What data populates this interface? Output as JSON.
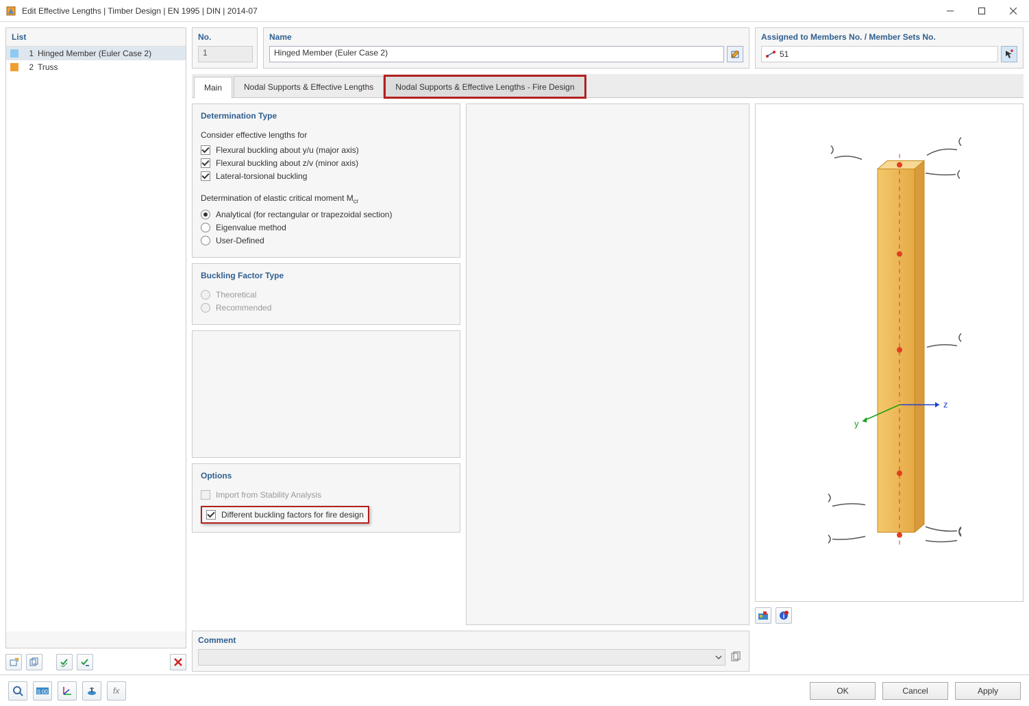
{
  "window": {
    "title": "Edit Effective Lengths | Timber Design | EN 1995 | DIN | 2014-07"
  },
  "list": {
    "header": "List",
    "items": [
      {
        "idx": "1",
        "name": "Hinged Member (Euler Case 2)",
        "color": "#8fcaf0",
        "selected": true
      },
      {
        "idx": "2",
        "name": "Truss",
        "color": "#f0a030",
        "selected": false
      }
    ]
  },
  "no_group": {
    "header": "No.",
    "value": "1"
  },
  "name_group": {
    "header": "Name",
    "value": "Hinged Member (Euler Case 2)"
  },
  "assigned_group": {
    "header": "Assigned to Members No. / Member Sets No.",
    "value": "51"
  },
  "tabs": {
    "main": "Main",
    "nodal": "Nodal Supports & Effective Lengths",
    "nodal_fire": "Nodal Supports & Effective Lengths - Fire Design"
  },
  "determination": {
    "header": "Determination Type",
    "sub1": "Consider effective lengths for",
    "c1": "Flexural buckling about y/u (major axis)",
    "c2": "Flexural buckling about z/v (minor axis)",
    "c3": "Lateral-torsional buckling",
    "sub2_pre": "Determination of elastic critical moment M",
    "sub2_sub": "cr",
    "r1": "Analytical (for rectangular or trapezoidal section)",
    "r2": "Eigenvalue method",
    "r3": "User-Defined"
  },
  "buckling_factor": {
    "header": "Buckling Factor Type",
    "r1": "Theoretical",
    "r2": "Recommended"
  },
  "options": {
    "header": "Options",
    "c1": "Import from Stability Analysis",
    "c2": "Different buckling factors for fire design"
  },
  "comment": {
    "header": "Comment"
  },
  "preview": {
    "y": "y",
    "z": "z"
  },
  "footer": {
    "ok": "OK",
    "cancel": "Cancel",
    "apply": "Apply"
  }
}
